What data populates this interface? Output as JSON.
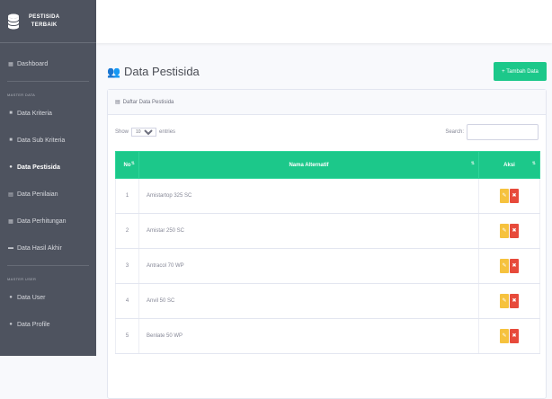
{
  "brand": {
    "line1": "PESTISIDA",
    "line2": "TERBAIK"
  },
  "sidebar": {
    "dashboard": "Dashboard",
    "heading1": "MASTER DATA",
    "items": [
      "Data Kriteria",
      "Data Sub Kriteria",
      "Data Pestisida",
      "Data Penilaian",
      "Data Perhitungan",
      "Data Hasil Akhir"
    ],
    "heading2": "MASTER USER",
    "items2": [
      "Data User",
      "Data Profile"
    ]
  },
  "page": {
    "title": "Data Pestisida",
    "add_button": "+ Tambah Data"
  },
  "card": {
    "header": "Daftar Data Pestisida"
  },
  "controls": {
    "show_label": "Show",
    "show_value": "10",
    "entries_label": "entries",
    "search_label": "Search:"
  },
  "table": {
    "headers": [
      "No",
      "Nama Alternatif",
      "Aksi"
    ],
    "rows": [
      {
        "no": "1",
        "nama": "Amistartop 325 SC"
      },
      {
        "no": "2",
        "nama": "Amistar 250 SC"
      },
      {
        "no": "3",
        "nama": "Antracol 70 WP"
      },
      {
        "no": "4",
        "nama": "Anvil 50 SC"
      },
      {
        "no": "5",
        "nama": "Benlate 50 WP"
      }
    ]
  },
  "colors": {
    "sidebar": "#4e535f",
    "accent": "#1cc88a",
    "edit": "#f6c23e",
    "delete": "#e74a3b"
  }
}
